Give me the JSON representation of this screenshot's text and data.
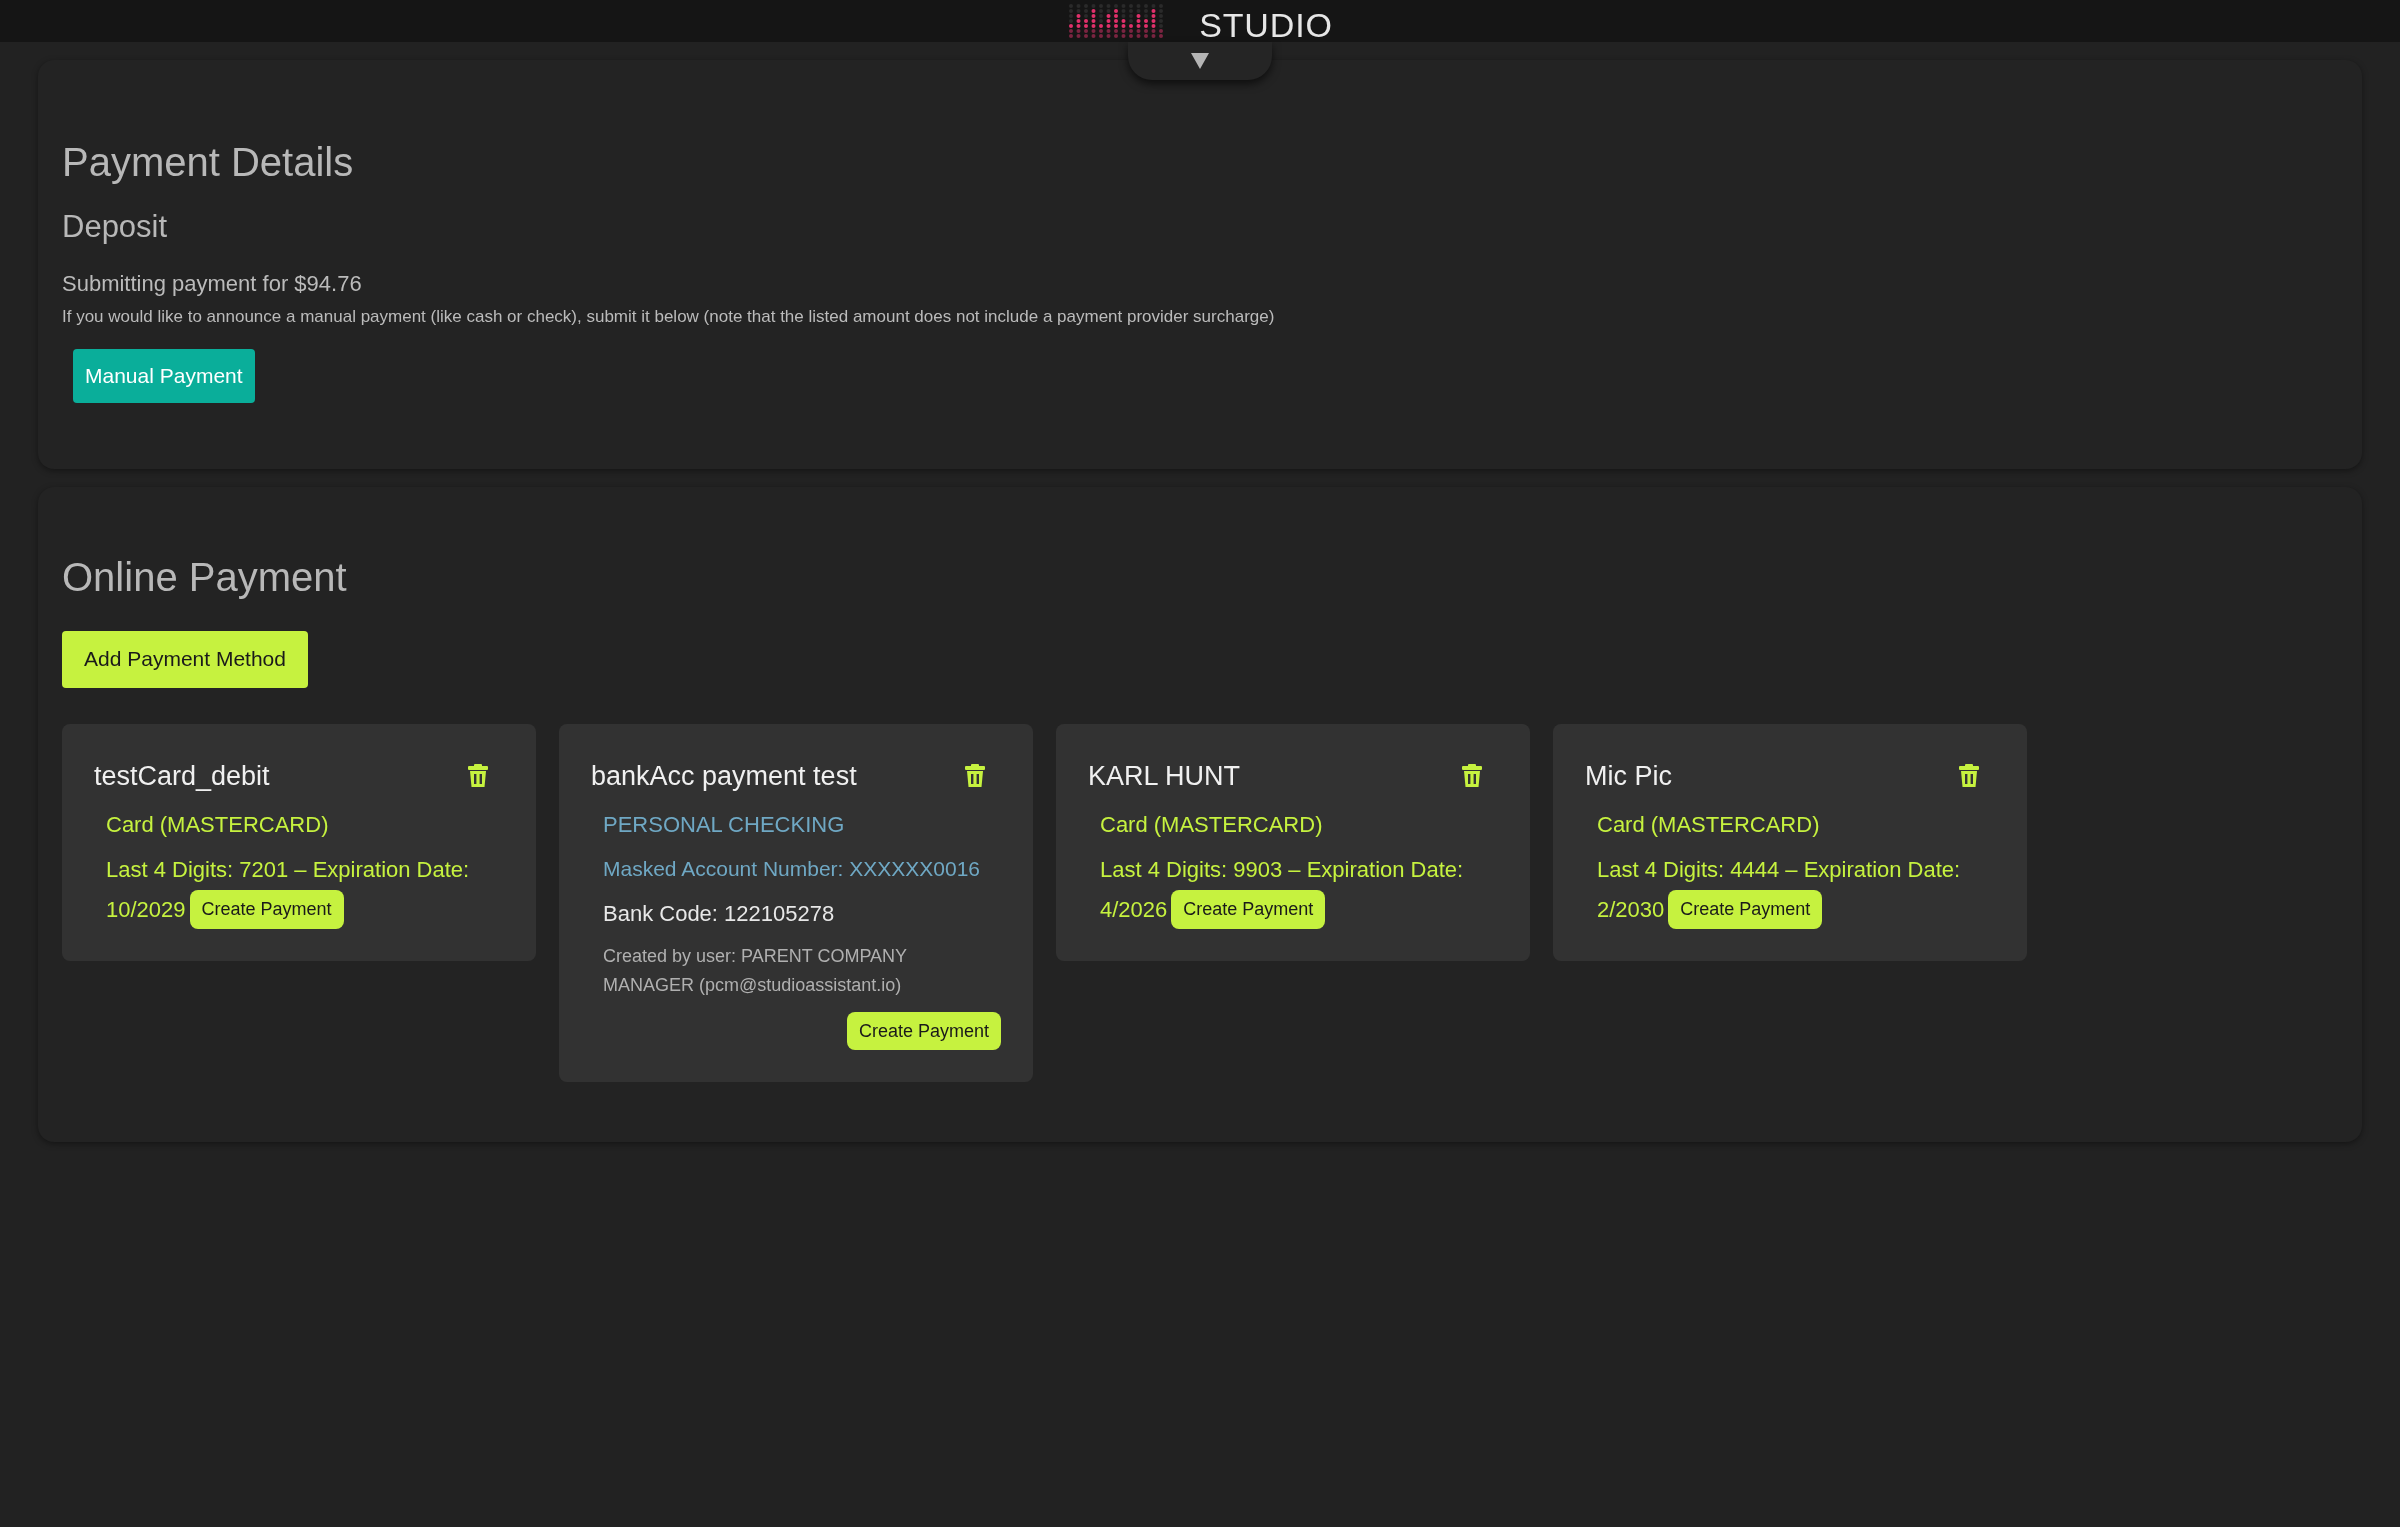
{
  "header": {
    "logo_text": "STUDIO"
  },
  "payment_details": {
    "title": "Payment Details",
    "section": "Deposit",
    "summary": "Submitting payment for $94.76",
    "note": "If you would like to announce a manual payment (like cash or check), submit it below (note that the listed amount does not include a payment provider surcharge)",
    "button": "Manual Payment"
  },
  "online_payment": {
    "title": "Online Payment",
    "add_button": "Add Payment Method",
    "methods": [
      {
        "kind": "card",
        "name": "testCard_debit",
        "type_label": "Card (MASTERCARD)",
        "details": "Last 4 Digits: 7201 – Expiration Date:",
        "expiry": "10/2029",
        "button": "Create Payment"
      },
      {
        "kind": "bank",
        "name": "bankAcc payment test",
        "type_label": "PERSONAL CHECKING",
        "masked": "Masked Account Number: XXXXXX0016",
        "bank_code": "Bank Code: 122105278",
        "created_by": "Created by user: PARENT COMPANY MANAGER (pcm@studioassistant.io)",
        "button": "Create Payment"
      },
      {
        "kind": "card",
        "name": "KARL HUNT",
        "type_label": "Card (MASTERCARD)",
        "details": "Last 4 Digits: 9903 – Expiration Date:",
        "expiry": "4/2026",
        "button": "Create Payment"
      },
      {
        "kind": "card",
        "name": "Mic Pic",
        "type_label": "Card (MASTERCARD)",
        "details": "Last 4 Digits: 4444 – Expiration Date:",
        "expiry": "2/2030",
        "button": "Create Payment"
      }
    ]
  }
}
